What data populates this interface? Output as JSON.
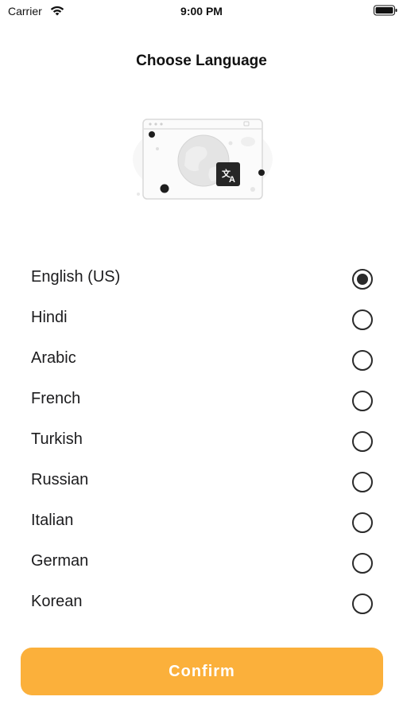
{
  "status_bar": {
    "carrier": "Carrier",
    "time": "9:00 PM",
    "icons": [
      "wifi-icon",
      "battery-icon"
    ]
  },
  "page": {
    "title": "Choose Language"
  },
  "illustration": {
    "icon": "translate-icon"
  },
  "languages": [
    {
      "label": "English (US)",
      "selected": true
    },
    {
      "label": "Hindi",
      "selected": false
    },
    {
      "label": "Arabic",
      "selected": false
    },
    {
      "label": "French",
      "selected": false
    },
    {
      "label": "Turkish",
      "selected": false
    },
    {
      "label": "Russian",
      "selected": false
    },
    {
      "label": "Italian",
      "selected": false
    },
    {
      "label": "German",
      "selected": false
    },
    {
      "label": "Korean",
      "selected": false
    }
  ],
  "confirm_button": {
    "label": "Confirm"
  },
  "colors": {
    "accent": "#fbb03b",
    "text": "#1c1c1e",
    "radio": "#2a2a2a"
  }
}
